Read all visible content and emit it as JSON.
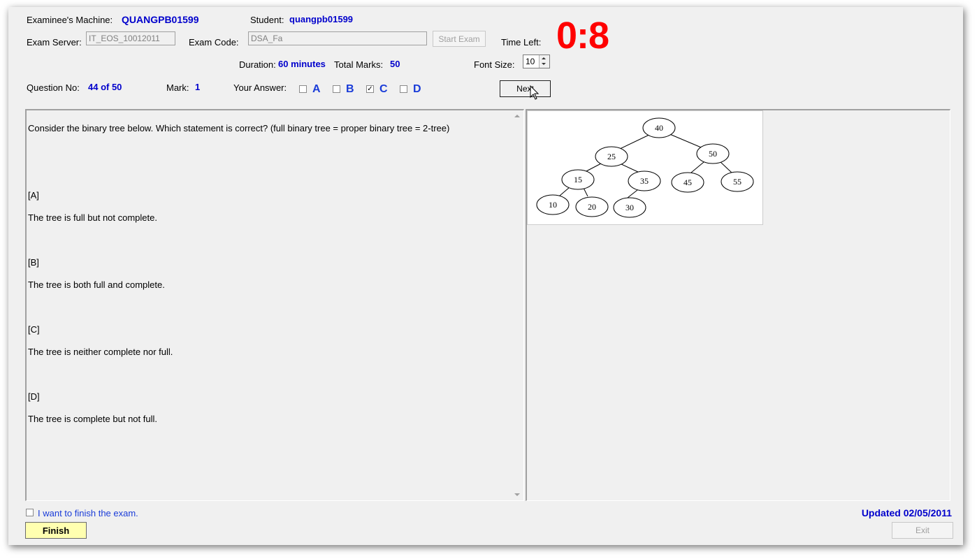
{
  "header": {
    "machine_label": "Examinee's Machine:",
    "machine_value": "QUANGPB01599",
    "student_label": "Student:",
    "student_value": "quangpb01599",
    "server_label": "Exam Server:",
    "server_value": "IT_EOS_10012011",
    "code_label": "Exam Code:",
    "code_value": "DSA_Fa",
    "start_exam": "Start Exam",
    "time_left_label": "Time Left:",
    "time_left_value": "0:8",
    "duration_label": "Duration:",
    "duration_value": "60 minutes",
    "total_marks_label": "Total Marks:",
    "total_marks_value": "50",
    "font_size_label": "Font Size:",
    "font_size_value": "10"
  },
  "question_bar": {
    "question_no_label": "Question No:",
    "question_no_value": "44 of 50",
    "mark_label": "Mark:",
    "mark_value": "1",
    "your_answer_label": "Your Answer:",
    "options": [
      {
        "letter": "A",
        "checked": false
      },
      {
        "letter": "B",
        "checked": false
      },
      {
        "letter": "C",
        "checked": true
      },
      {
        "letter": "D",
        "checked": false
      }
    ],
    "next_label": "Next"
  },
  "question": {
    "stem": "Consider the binary tree below. Which statement is correct? (full binary tree = proper binary tree = 2-tree)",
    "answers": [
      {
        "tag": "[A]",
        "text": "The tree is full but not complete."
      },
      {
        "tag": "[B]",
        "text": "The tree is both full and complete."
      },
      {
        "tag": "[C]",
        "text": "The tree is neither complete nor full."
      },
      {
        "tag": "[D]",
        "text": "The tree is complete but not full."
      }
    ]
  },
  "tree_image": {
    "nodes": [
      "40",
      "25",
      "50",
      "15",
      "35",
      "45",
      "55",
      "10",
      "20",
      "30"
    ]
  },
  "footer": {
    "finish_check_label": "I want to finish the exam.",
    "finish_label": "Finish",
    "updated": "Updated 02/05/2011",
    "exit_label": "Exit"
  },
  "colors": {
    "value_blue": "#0000cc",
    "timer_red": "#ff0000",
    "finish_bg": "#ffffb0",
    "window_bg": "#f0f0f0"
  }
}
